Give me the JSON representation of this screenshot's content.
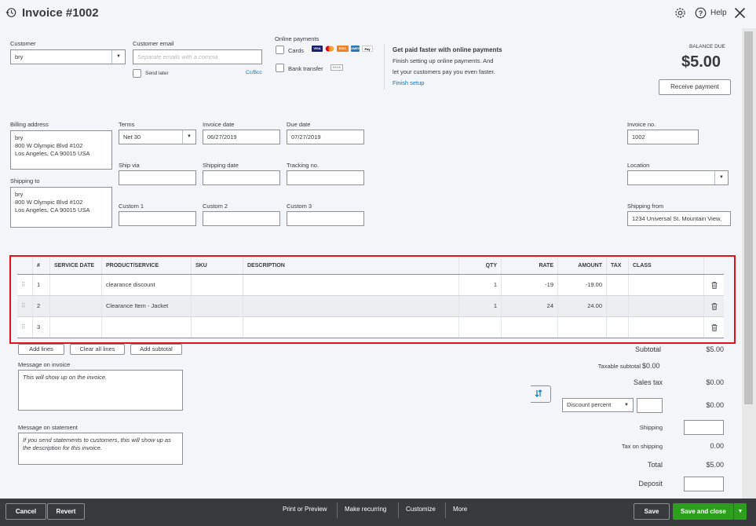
{
  "header": {
    "title": "Invoice #1002",
    "help_label": "Help"
  },
  "customer": {
    "label": "Customer",
    "value": "bry"
  },
  "customer_email": {
    "label": "Customer email",
    "placeholder": "Separate emails with a comma",
    "send_later": "Send later",
    "cc_bcc": "Cc/Bcc"
  },
  "online_payments": {
    "label": "Online payments",
    "cards": "Cards",
    "bank_transfer": "Bank transfer",
    "bank_logo": "BANK"
  },
  "promo": {
    "title": "Get paid faster with online payments",
    "line1": "Finish setting up online payments. And",
    "line2": "let your customers pay you even faster.",
    "link": "Finish setup"
  },
  "balance": {
    "label": "BALANCE DUE",
    "amount": "$5.00",
    "receive_payment": "Receive payment"
  },
  "billing": {
    "label": "Billing address",
    "value": "bry\n800 W Olympic Blvd #102\nLos Angeles, CA  90015 USA"
  },
  "shipping_to": {
    "label": "Shipping to",
    "value": "bry\n800 W Olympic Blvd #102\nLos Angeles, CA  90015 USA"
  },
  "terms": {
    "label": "Terms",
    "value": "Net 30"
  },
  "invoice_date": {
    "label": "Invoice date",
    "value": "06/27/2019"
  },
  "due_date": {
    "label": "Due date",
    "value": "07/27/2019"
  },
  "invoice_no": {
    "label": "Invoice no.",
    "value": "1002"
  },
  "ship_via": {
    "label": "Ship via"
  },
  "shipping_date": {
    "label": "Shipping date"
  },
  "tracking_no": {
    "label": "Tracking no."
  },
  "location": {
    "label": "Location"
  },
  "custom1": {
    "label": "Custom 1"
  },
  "custom2": {
    "label": "Custom 2"
  },
  "custom3": {
    "label": "Custom 3"
  },
  "shipping_from": {
    "label": "Shipping from",
    "value": "1234 Universal St. Mountain View,"
  },
  "table": {
    "headers": {
      "num": "#",
      "service_date": "SERVICE DATE",
      "product": "PRODUCT/SERVICE",
      "sku": "SKU",
      "description": "DESCRIPTION",
      "qty": "QTY",
      "rate": "RATE",
      "amount": "AMOUNT",
      "tax": "TAX",
      "class": "CLASS"
    },
    "rows": [
      {
        "num": "1",
        "product": "clearance discount",
        "qty": "1",
        "rate": "-19",
        "amount": "-19.00"
      },
      {
        "num": "2",
        "product": "Clearance Item - Jacket",
        "qty": "1",
        "rate": "24",
        "amount": "24.00"
      },
      {
        "num": "3",
        "product": "",
        "qty": "",
        "rate": "",
        "amount": ""
      }
    ]
  },
  "line_buttons": {
    "add_lines": "Add lines",
    "clear_all": "Clear all lines",
    "add_subtotal": "Add subtotal"
  },
  "message_invoice": {
    "label": "Message on invoice",
    "placeholder": "This will show up on the invoice."
  },
  "message_statement": {
    "label": "Message on statement",
    "placeholder": "If you send statements to customers, this will show up as\nthe description for this invoice."
  },
  "totals": {
    "subtotal_label": "Subtotal",
    "subtotal": "$5.00",
    "taxable_label": "Taxable subtotal",
    "taxable": "$0.00",
    "sales_tax_label": "Sales tax",
    "sales_tax": "$0.00",
    "discount_type": "Discount percent",
    "discount": "$0.00",
    "shipping_label": "Shipping",
    "tax_shipping_label": "Tax on shipping",
    "tax_shipping": "0.00",
    "total_label": "Total",
    "total": "$5.00",
    "deposit_label": "Deposit"
  },
  "footer": {
    "cancel": "Cancel",
    "revert": "Revert",
    "print": "Print or Preview",
    "recurring": "Make recurring",
    "customize": "Customize",
    "more": "More",
    "save": "Save",
    "save_close": "Save and close"
  },
  "colors": {
    "accent": "#0077c5",
    "primary_green": "#2ca01c",
    "footer_bg": "#393a3d",
    "highlight": "#e0131d"
  }
}
